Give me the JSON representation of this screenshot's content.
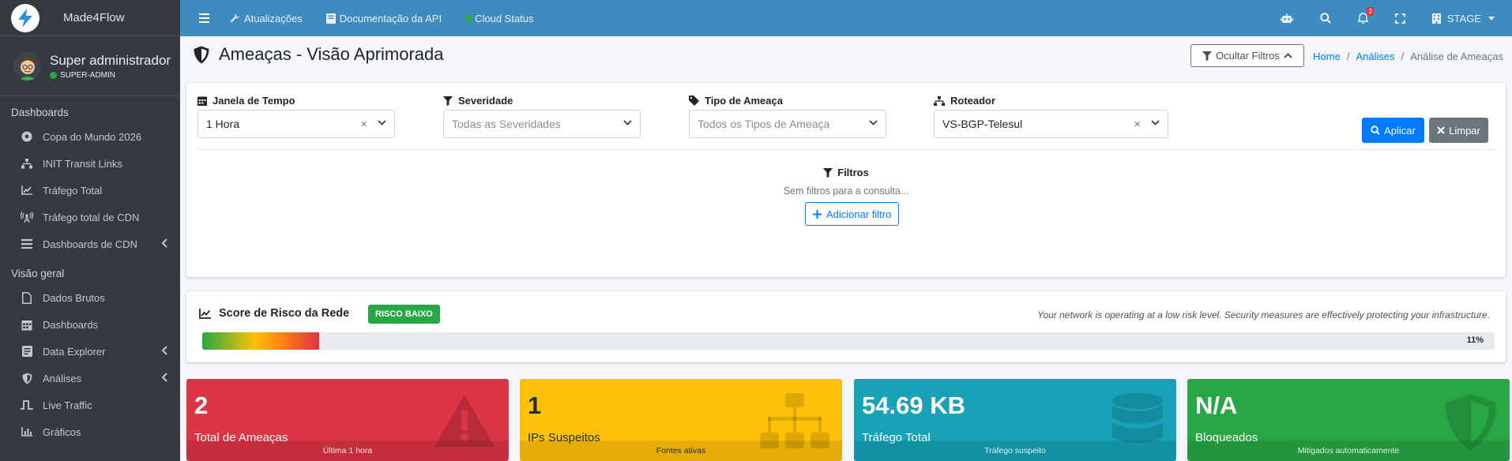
{
  "brand": {
    "name": "Made4Flow"
  },
  "user": {
    "name": "Super administrador",
    "role": "SUPER-ADMIN"
  },
  "sidebar": {
    "sections": [
      {
        "header": "Dashboards",
        "items": [
          {
            "label": "Copa do Mundo 2026",
            "icon": "soccer-ball-icon"
          },
          {
            "label": "INIT Transit Links",
            "icon": "sitemap-icon"
          },
          {
            "label": "Tráfego Total",
            "icon": "chart-line-icon"
          },
          {
            "label": "Tráfego total de CDN",
            "icon": "broadcast-tower-icon"
          },
          {
            "label": "Dashboards de CDN",
            "icon": "list-icon",
            "chevron": true
          }
        ]
      },
      {
        "header": "Visão geral",
        "items": [
          {
            "label": "Dados Brutos",
            "icon": "file-icon"
          },
          {
            "label": "Dashboards",
            "icon": "calendar-icon"
          },
          {
            "label": "Data Explorer",
            "icon": "file-alt-icon",
            "chevron": true
          },
          {
            "label": "Análises",
            "icon": "shield-icon",
            "chevron": true
          },
          {
            "label": "Live Traffic",
            "icon": "pulse-icon"
          },
          {
            "label": "Gráficos",
            "icon": "bar-chart-icon"
          }
        ]
      }
    ]
  },
  "topbar": {
    "links": [
      {
        "label": "Atualizações",
        "icon": "wrench-icon"
      },
      {
        "label": "Documentação da API",
        "icon": "book-icon"
      },
      {
        "label": "Cloud Status",
        "icon": "status-dot-icon"
      }
    ],
    "notification_count": "2",
    "environment": "STAGE"
  },
  "page": {
    "title": "Ameaças - Visão Aprimorada",
    "hide_filters_label": "Ocultar Filtros",
    "breadcrumb": [
      "Home",
      "Análises",
      "Análise de Ameaças"
    ]
  },
  "filters": {
    "time_window": {
      "label": "Janela de Tempo",
      "value": "1 Hora"
    },
    "severity": {
      "label": "Severidade",
      "placeholder": "Todas as Severidades"
    },
    "threat_type": {
      "label": "Tipo de Ameaça",
      "placeholder": "Todos os Tipos de Ameaça"
    },
    "router": {
      "label": "Roteador",
      "value": "VS-BGP-Telesul"
    },
    "apply_label": "Aplicar",
    "clear_label": "Limpar",
    "section_title": "Filtros",
    "empty_text": "Sem filtros para a consulta...",
    "add_label": "Adicionar filtro"
  },
  "risk": {
    "title": "Score de Risco da Rede",
    "badge": "RISCO BAIXO",
    "message": "Your network is operating at a low risk level. Security measures are effectively protecting your infrastructure.",
    "percent": 11,
    "percent_label": "11%"
  },
  "stats": [
    {
      "value": "2",
      "label": "Total de Ameaças",
      "footer": "Última 1 hora",
      "color": "#dc3545",
      "icon": "exclamation-triangle-icon"
    },
    {
      "value": "1",
      "label": "IPs Suspeitos",
      "footer": "Fontes ativas",
      "color": "#ffc107",
      "icon": "network-icon"
    },
    {
      "value": "54.69 KB",
      "label": "Tráfego Total",
      "footer": "Tráfego suspeito",
      "color": "#17a2b8",
      "icon": "database-icon"
    },
    {
      "value": "N/A",
      "label": "Bloqueados",
      "footer": "Mitigados automaticamente",
      "color": "#28a745",
      "icon": "shield-icon"
    }
  ]
}
